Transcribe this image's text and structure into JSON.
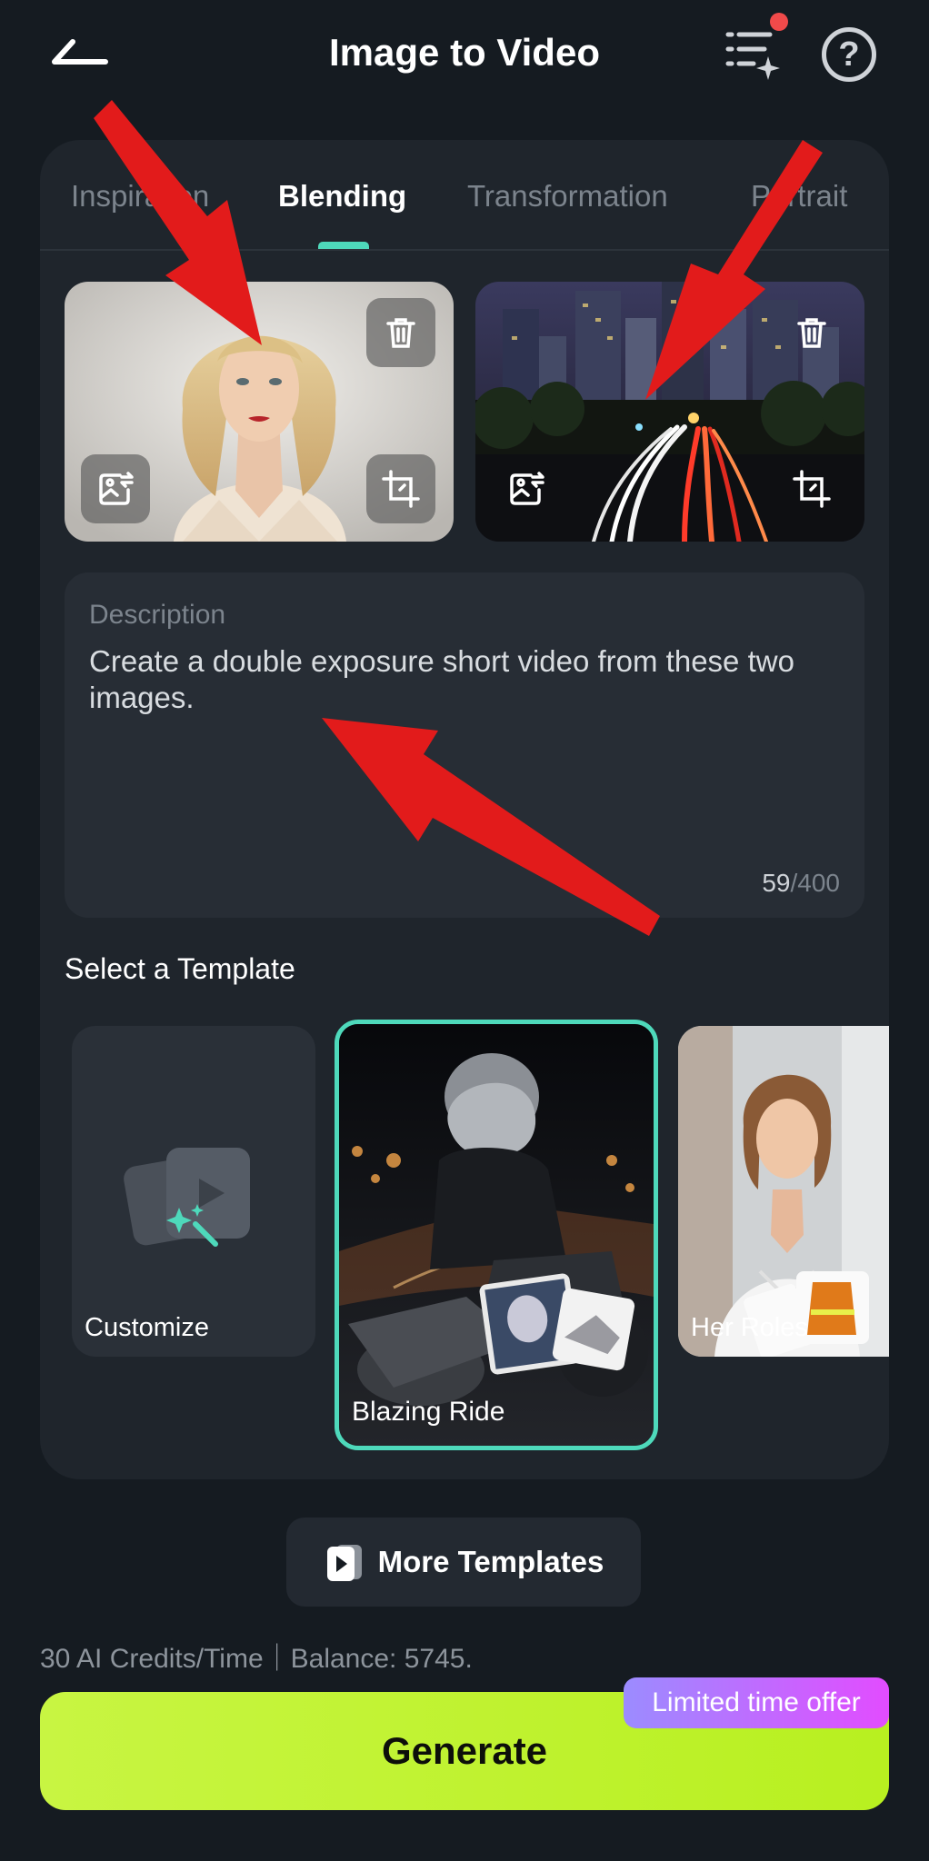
{
  "header": {
    "title": "Image to Video",
    "back_icon": "back-arrow-icon",
    "tasks_icon": "task-list-sparkle-icon",
    "help_icon": "question-circle-icon",
    "help_glyph": "?"
  },
  "tabs": [
    {
      "label": "Inspiration"
    },
    {
      "label": "Blending"
    },
    {
      "label": "Transformation"
    },
    {
      "label": "Portrait"
    }
  ],
  "active_tab": "Blending",
  "description": {
    "label": "Description",
    "text": "Create a double exposure short video from these two images.",
    "count": "59",
    "max": "/400"
  },
  "templates": {
    "title": "Select a Template",
    "items": [
      {
        "label": "Customize"
      },
      {
        "label": "Blazing Ride"
      },
      {
        "label": "Her Roles"
      }
    ]
  },
  "more_templates": {
    "label": "More Templates"
  },
  "credits_text": "30 AI Credits/Time｜Balance: 5745.",
  "generate": {
    "label": "Generate",
    "badge": "Limited time offer"
  },
  "colors": {
    "accent": "#4ed9bb",
    "generate": "#c8f542",
    "badge_start": "#9b8cff",
    "badge_end": "#e24cff",
    "notification_dot": "#f04a4a",
    "annotation_arrow": "#e21b1b"
  }
}
